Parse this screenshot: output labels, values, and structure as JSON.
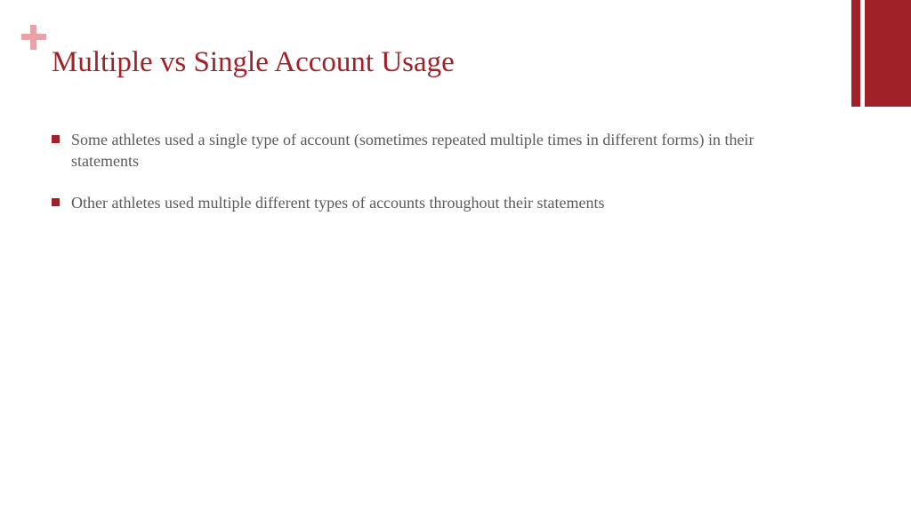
{
  "slide": {
    "title": "Multiple vs Single Account Usage",
    "bullets": [
      "Some athletes used a single type of account (sometimes repeated multiple times in different forms) in their statements",
      "Other athletes used multiple different types of accounts throughout their statements"
    ]
  }
}
